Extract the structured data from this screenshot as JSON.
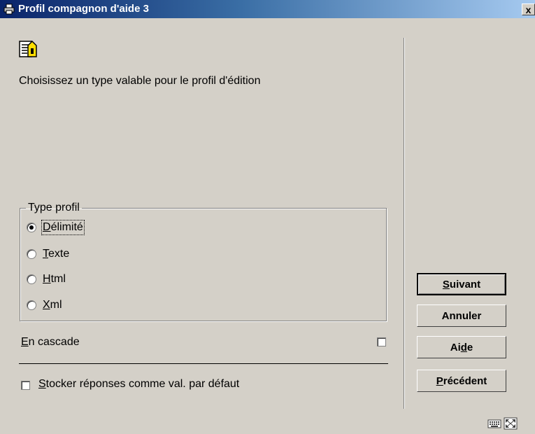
{
  "window": {
    "title": "Profil compagnon d'aide 3",
    "close_label": "x"
  },
  "main": {
    "instruction": "Choisissez un type valable pour le profil d'édition",
    "group_legend": "Type profil",
    "options": [
      {
        "accel": "D",
        "rest": "élimité",
        "selected": true
      },
      {
        "accel": "T",
        "rest": "exte",
        "selected": false
      },
      {
        "accel": "H",
        "rest": "tml",
        "selected": false
      },
      {
        "accel": "X",
        "rest": "ml",
        "selected": false
      }
    ],
    "cascade": {
      "accel": "E",
      "rest": "n cascade",
      "checked": false
    },
    "store_defaults": {
      "accel": "S",
      "rest": "tocker réponses comme val. par défaut",
      "checked": false
    }
  },
  "buttons": {
    "next": {
      "accel": "S",
      "rest": "uivant"
    },
    "cancel": {
      "label": "Annuler"
    },
    "help": {
      "pre": "Ai",
      "accel": "d",
      "rest": "e"
    },
    "prev": {
      "accel": "P",
      "rest": "récédent"
    }
  },
  "colors": {
    "titlebar_start": "#0a246a",
    "titlebar_end": "#a6caf0",
    "face": "#d4d0c8"
  }
}
